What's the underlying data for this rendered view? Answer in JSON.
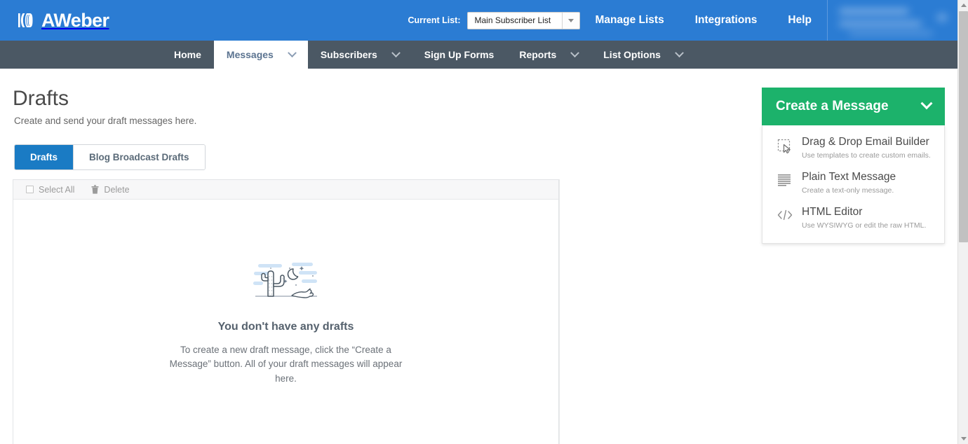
{
  "brand": {
    "name": "AWeber",
    "logo_icon": "aweber-logo-icon",
    "blue": "#2b7cd3",
    "nav_dark": "#4b5864",
    "accent_green": "#1cb26b",
    "accent_blue": "#1a7bc4"
  },
  "topbar": {
    "current_list_label": "Current List:",
    "current_list_value": "Main Subscriber List",
    "dropdown_icon": "chevron-down-icon",
    "links": [
      {
        "label": "Manage Lists",
        "name": "manage-lists"
      },
      {
        "label": "Integrations",
        "name": "integrations"
      },
      {
        "label": "Help",
        "name": "help"
      }
    ],
    "account_area_redacted": true
  },
  "mainnav": {
    "items": [
      {
        "label": "Home",
        "has_caret": false,
        "active": false
      },
      {
        "label": "Messages",
        "has_caret": true,
        "active": true
      },
      {
        "label": "Subscribers",
        "has_caret": true,
        "active": false
      },
      {
        "label": "Sign Up Forms",
        "has_caret": false,
        "active": false
      },
      {
        "label": "Reports",
        "has_caret": true,
        "active": false
      },
      {
        "label": "List Options",
        "has_caret": true,
        "active": false
      }
    ]
  },
  "page": {
    "title": "Drafts",
    "subtitle": "Create and send your draft messages here."
  },
  "tabs": [
    {
      "label": "Drafts",
      "active": true
    },
    {
      "label": "Blog Broadcast Drafts",
      "active": false
    }
  ],
  "table_toolbar": {
    "select_all_label": "Select All",
    "select_all_checked": false,
    "delete_label": "Delete",
    "delete_icon": "trash-icon"
  },
  "empty_state": {
    "illustration": "desert-cactus-night-illustration",
    "title": "You don't have any drafts",
    "description": "To create a new draft message, click the “Create a Message” button. All of your draft messages will appear here."
  },
  "create_message": {
    "button_label": "Create a Message",
    "button_caret_icon": "chevron-down-icon",
    "expanded": true,
    "options": [
      {
        "title": "Drag & Drop Email Builder",
        "subtitle": "Use templates to create custom emails.",
        "icon": "drag-drop-cursor-icon"
      },
      {
        "title": "Plain Text Message",
        "subtitle": "Create a text-only message.",
        "icon": "text-lines-icon"
      },
      {
        "title": "HTML Editor",
        "subtitle": "Use WYSIWYG or edit the raw HTML.",
        "icon": "code-brackets-icon"
      }
    ]
  },
  "scrollbar": {
    "up_icon": "scroll-up-arrow-icon",
    "down_icon": "scroll-down-arrow-icon"
  }
}
